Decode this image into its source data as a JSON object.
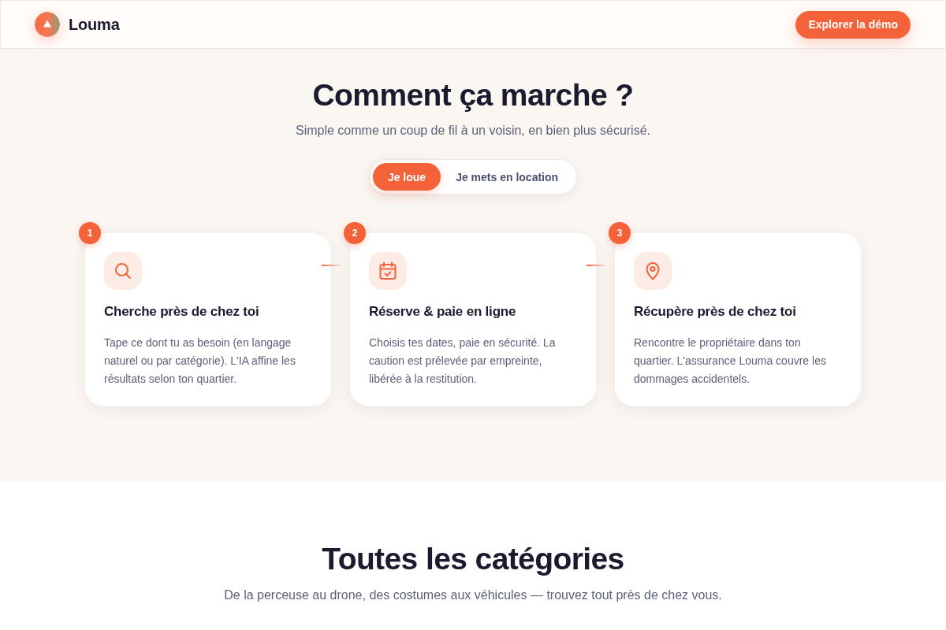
{
  "header": {
    "brand": "Louma",
    "cta": "Explorer la démo"
  },
  "how_it_works": {
    "title": "Comment ça marche ?",
    "subtitle": "Simple comme un coup de fil à un voisin, en bien plus sécurisé.",
    "tabs": [
      {
        "label": "Je loue",
        "selected": true
      },
      {
        "label": "Je mets en location",
        "selected": false
      }
    ],
    "steps": [
      {
        "number": "1",
        "title": "Cherche près de chez toi",
        "description": "Tape ce dont tu as besoin (en langage naturel ou par catégorie). L'IA affine les résultats selon ton quartier."
      },
      {
        "number": "2",
        "title": "Réserve & paie en ligne",
        "description": "Choisis tes dates, paie en sécurité. La caution est prélevée par empreinte, libérée à la restitution."
      },
      {
        "number": "3",
        "title": "Récupère près de chez toi",
        "description": "Rencontre le propriétaire dans ton quartier. L'assurance Louma couvre les dommages accidentels."
      }
    ]
  },
  "categories": {
    "title": "Toutes les catégories",
    "subtitle": "De la perceuse au drone, des costumes aux véhicules — trouvez tout près de chez vous."
  }
}
